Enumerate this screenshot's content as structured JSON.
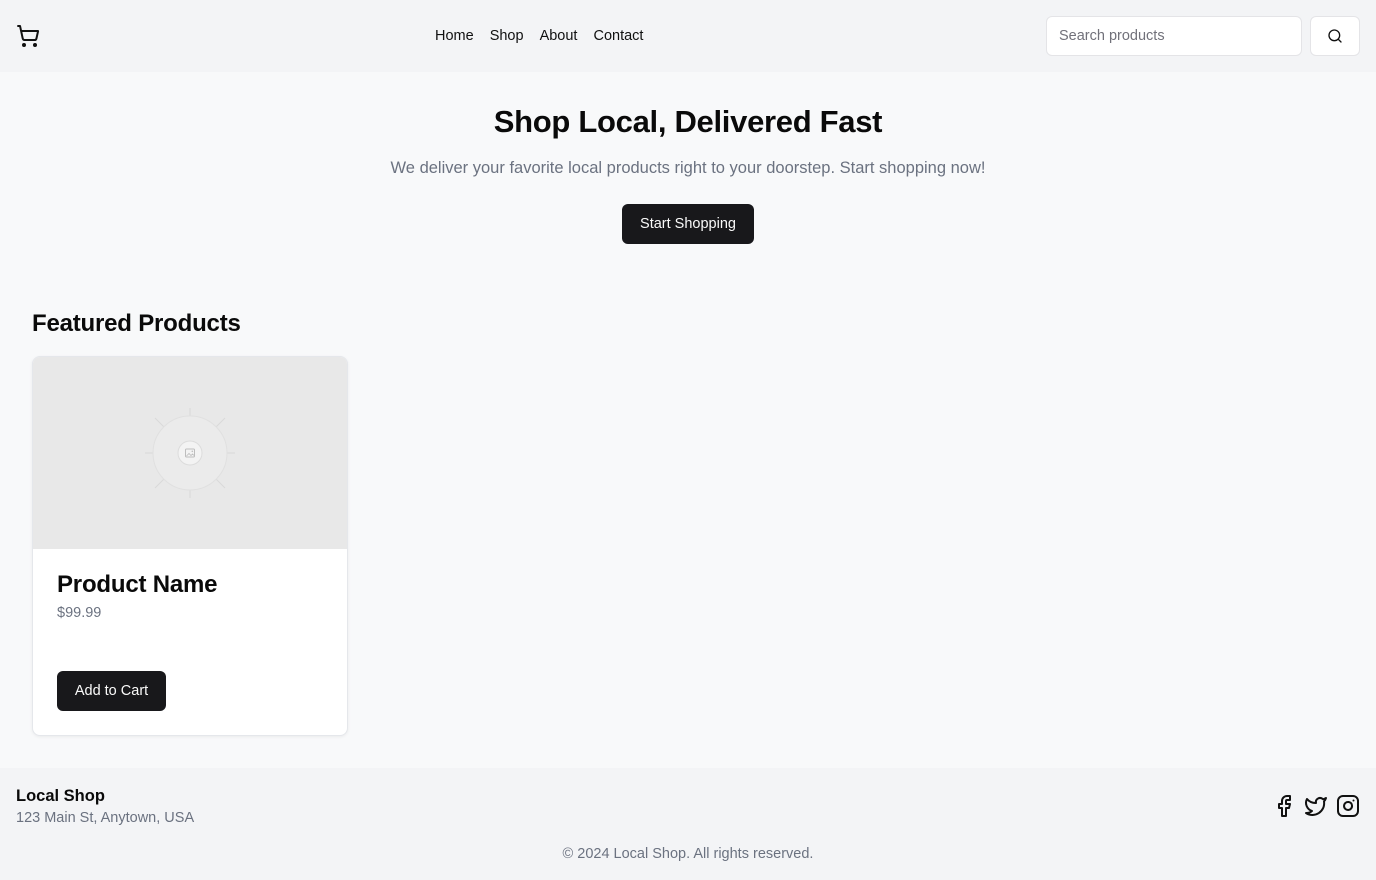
{
  "header": {
    "logo_icon": "shopping-cart-icon",
    "nav": [
      {
        "label": "Home"
      },
      {
        "label": "Shop"
      },
      {
        "label": "About"
      },
      {
        "label": "Contact"
      }
    ],
    "search": {
      "placeholder": "Search products",
      "value": "",
      "button_icon": "search-icon"
    }
  },
  "hero": {
    "title": "Shop Local, Delivered Fast",
    "subtitle": "We deliver your favorite local products right to your doorstep. Start shopping now!",
    "cta_label": "Start Shopping"
  },
  "featured": {
    "title": "Featured Products",
    "products": [
      {
        "name": "Product Name",
        "price": "$99.99",
        "button_label": "Add to Cart",
        "image_icon": "image-placeholder-icon"
      }
    ]
  },
  "footer": {
    "shop_name": "Local Shop",
    "address": "123 Main St, Anytown, USA",
    "socials": [
      "facebook-icon",
      "twitter-icon",
      "instagram-icon"
    ],
    "copyright": "© 2024 Local Shop. All rights reserved."
  },
  "colors": {
    "primary_button": "#18181b",
    "page_bg": "#f8f9fa",
    "header_bg": "#f3f4f6",
    "muted_text": "#6b7280"
  }
}
